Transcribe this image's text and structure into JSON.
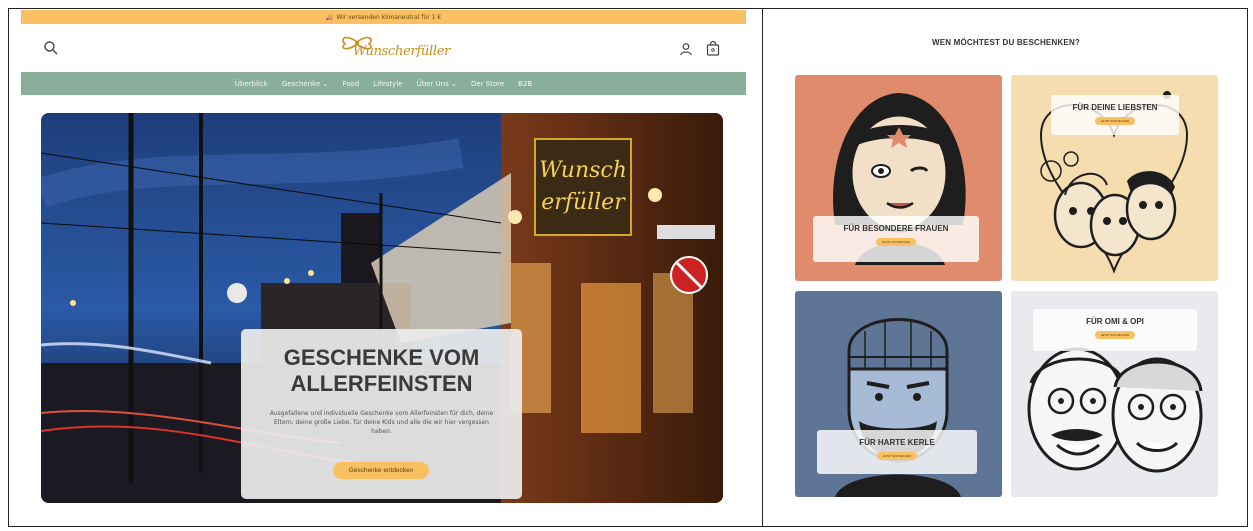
{
  "announcement": {
    "text": "Wir versenden klimaneutral für 1 €",
    "icon": "truck-icon"
  },
  "header": {
    "logo_text": "Wunscherfüller",
    "icons": {
      "search": "search-icon",
      "account": "account-icon",
      "cart": "cart-icon"
    }
  },
  "nav": {
    "items": [
      {
        "label": "Überblick"
      },
      {
        "label": "Geschenke ⌄"
      },
      {
        "label": "Food"
      },
      {
        "label": "Lifestyle"
      },
      {
        "label": "Über Uns ⌄"
      },
      {
        "label": "Der Store"
      },
      {
        "label": "B2B"
      }
    ]
  },
  "hero": {
    "sign_line1": "Wunsch",
    "sign_line2": "erfüller",
    "title": "GESCHENKE VOM ALLERFEINSTEN",
    "text": "Ausgefallene und individuelle Geschenke vom Allerfeinsten für dich, deine Eltern, deine große Liebe, für deine Kids und alle die wir hier vergessen haben.",
    "cta": "Geschenke entdecken"
  },
  "recipients": {
    "heading": "WEN MÖCHTEST DU BESCHENKEN?",
    "tiles": [
      {
        "title": "FÜR BESONDERE FRAUEN",
        "button": "JETZT ENTDECKEN"
      },
      {
        "title": "FÜR DEINE LIEBSTEN",
        "button": "JETZT ENTDECKEN"
      },
      {
        "title": "FÜR HARTE KERLE",
        "button": "JETZT ENTDECKEN"
      },
      {
        "title": "FÜR OMI & OPI",
        "button": "JETZT ENTDECKEN"
      }
    ]
  },
  "colors": {
    "announcement_bg": "#f9c061",
    "nav_bg": "#8aae9c",
    "cta_bg": "#f9c061",
    "tile_women": "#e08c6c",
    "tile_loved": "#f5ddb0",
    "tile_men": "#5f7596",
    "tile_grandparents": "#e8eaee"
  }
}
